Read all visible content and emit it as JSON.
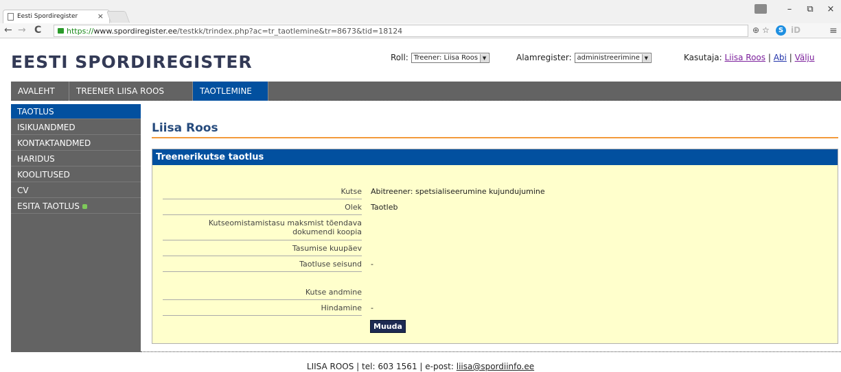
{
  "browser": {
    "tab_title": "Eesti Spordiregister",
    "tab_close": "×",
    "url_green": "https://",
    "url_domain": "www.spordiregister.ee",
    "url_path": "/testkk/trindex.php?ac=tr_taotlemine&tr=8673&tid=18124",
    "back": "←",
    "forward": "→",
    "reload": "C",
    "win_min": "–",
    "win_max": "⧉",
    "win_close": "×",
    "ext_zoom": "⊕",
    "ext_star": "☆",
    "ext_s": "S",
    "ext_id": "iD",
    "ext_menu": "≡"
  },
  "header": {
    "logo": "EESTI SPORDIREGISTER",
    "role_label": "Roll:",
    "role_value": "Treener: Liisa Roos",
    "subregister_label": "Alamregister:",
    "subregister_value": "administreerimine",
    "user_label": "Kasutaja:",
    "user_name": "Liisa Roos",
    "help": "Abi",
    "logout": "Välju",
    "sep": "|"
  },
  "topnav": [
    "AVALEHT",
    "TREENER LIISA ROOS",
    "TAOTLEMINE"
  ],
  "sidebar": [
    "TAOTLUS",
    "ISIKUANDMED",
    "KONTAKTANDMED",
    "HARIDUS",
    "KOOLITUSED",
    "CV",
    "ESITA TAOTLUS"
  ],
  "main": {
    "title": "Liisa Roos",
    "panel_title": "Treenerikutse taotlus",
    "fields": [
      {
        "label": "Kutse",
        "value": "Abitreener: spetsialiseerumine kujundujumine"
      },
      {
        "label": "Olek",
        "value": "Taotleb"
      },
      {
        "label": "Kutseomistamistasu maksmist tõendava dokumendi koopia",
        "value": ""
      },
      {
        "label": "Tasumise kuupäev",
        "value": ""
      },
      {
        "label": "Taotluse seisund",
        "value": "-"
      },
      {
        "label": "Kutse andmine",
        "value": ""
      },
      {
        "label": "Hindamine",
        "value": "-"
      }
    ],
    "button": "Muuda"
  },
  "footer": {
    "text": "LIISA ROOS | tel: 603 1561 | e-post: ",
    "email": "liisa@spordiinfo.ee"
  }
}
